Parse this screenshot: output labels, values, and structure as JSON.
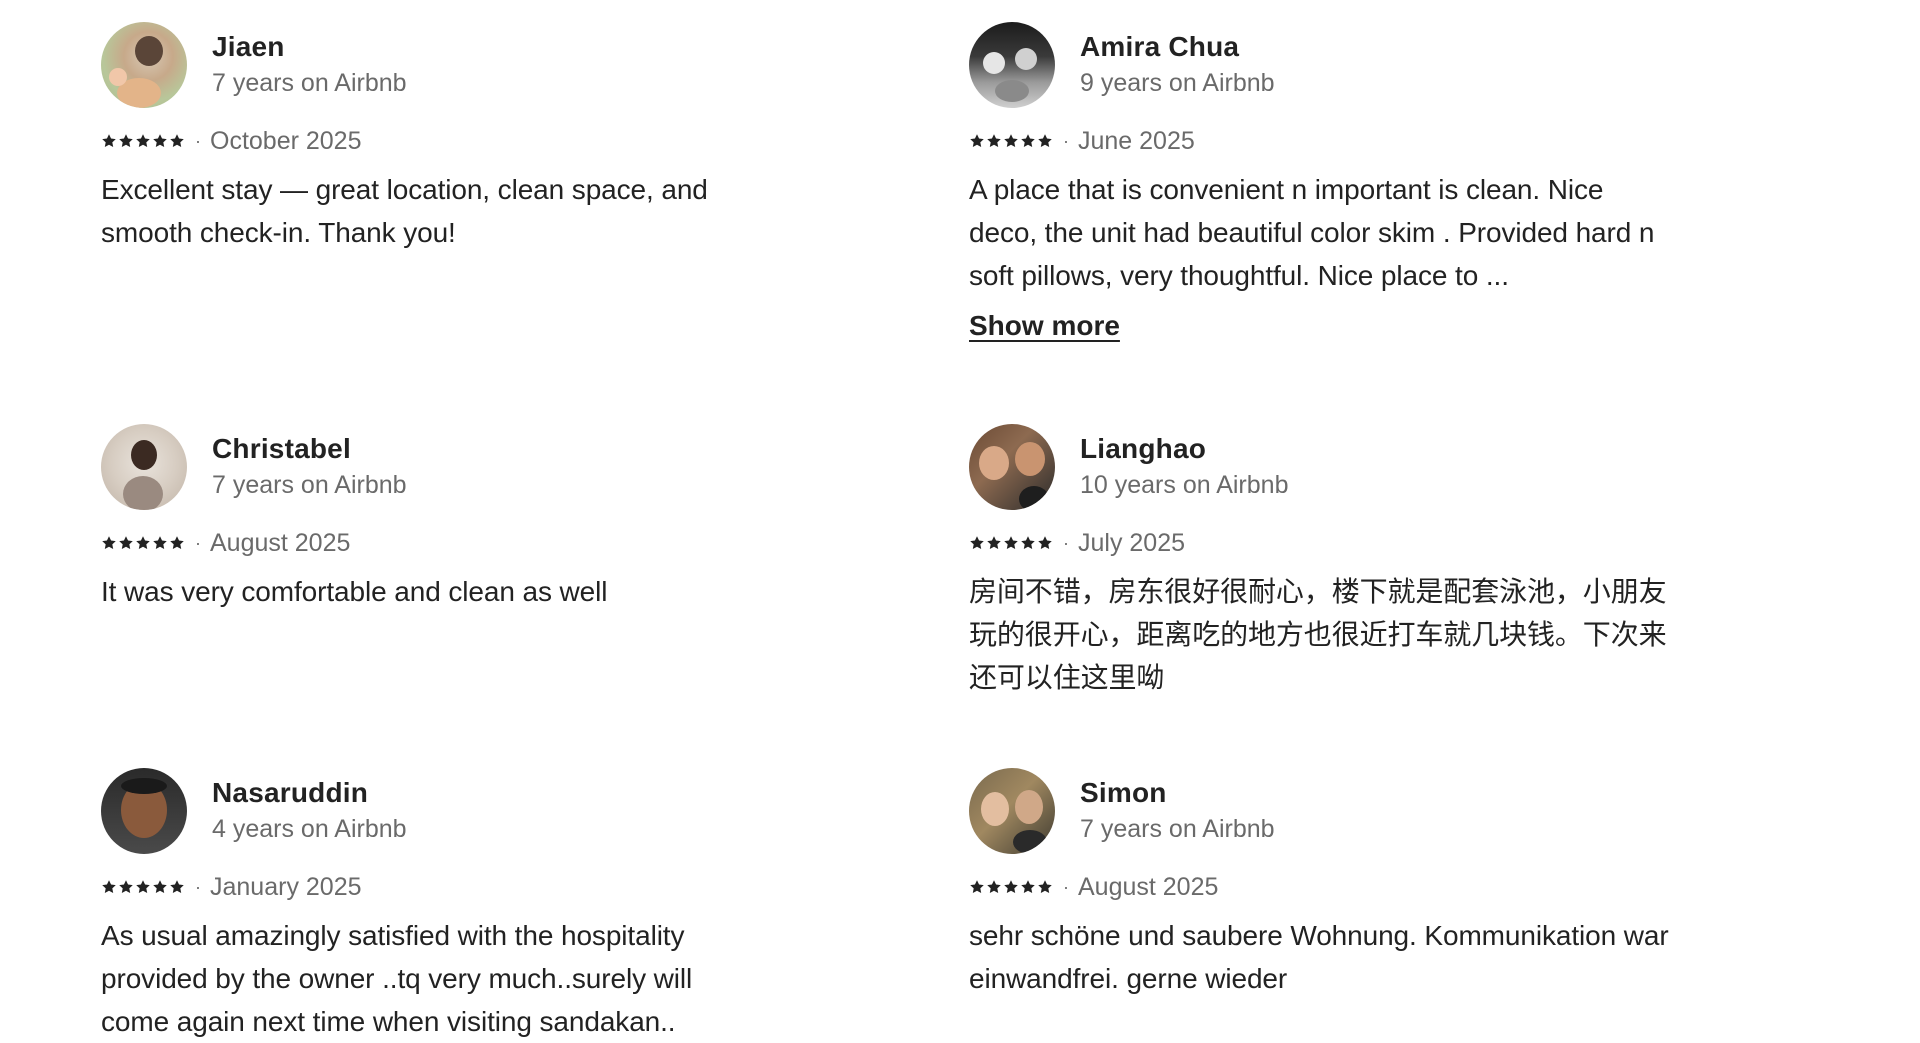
{
  "reviews": [
    {
      "name": "Jiaen",
      "tenure": "7 years on Airbnb",
      "rating": 5,
      "date": "October 2025",
      "text": "Excellent stay — great location, clean space, and smooth check-in. Thank you!",
      "show_more": ""
    },
    {
      "name": "Amira Chua",
      "tenure": "9 years on Airbnb",
      "rating": 5,
      "date": "June 2025",
      "text": "A place that is convenient n important is clean. Nice deco, the unit had beautiful color skim . Provided hard n soft pillows, very thoughtful. Nice place to ...",
      "show_more": "Show more"
    },
    {
      "name": "Christabel",
      "tenure": "7 years on Airbnb",
      "rating": 5,
      "date": "August 2025",
      "text": "It was very comfortable and clean as well",
      "show_more": ""
    },
    {
      "name": "Lianghao",
      "tenure": "10 years on Airbnb",
      "rating": 5,
      "date": "July 2025",
      "text": "房间不错，房东很好很耐心，楼下就是配套泳池，小朋友玩的很开心，距离吃的地方也很近打车就几块钱。下次来还可以住这里呦",
      "show_more": ""
    },
    {
      "name": "Nasaruddin",
      "tenure": "4 years on Airbnb",
      "rating": 5,
      "date": "January 2025",
      "text": "As usual amazingly satisfied with the hospitality provided by the owner ..tq very much..surely will come again next time when visiting sandakan..",
      "show_more": ""
    },
    {
      "name": "Simon",
      "tenure": "7 years on Airbnb",
      "rating": 5,
      "date": "August 2025",
      "text": "sehr schöne und saubere Wohnung. Kommunikation war einwandfrei. gerne wieder",
      "show_more": ""
    }
  ],
  "separator": "·",
  "icons": {
    "star": "star-icon"
  },
  "colors": {
    "text": "#222222",
    "muted": "#6a6a6a"
  }
}
